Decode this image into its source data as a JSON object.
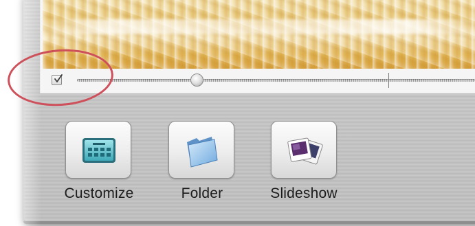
{
  "viewer": {
    "show_checkbox_checked": true,
    "zoom_slider_value": 0.3
  },
  "toolbar": {
    "items": [
      {
        "label": "Customize",
        "icon": "customize-grid-icon"
      },
      {
        "label": "Folder",
        "icon": "folder-icon"
      },
      {
        "label": "Slideshow",
        "icon": "slideshow-icon"
      }
    ]
  },
  "annotation": {
    "highlight_color": "#cd505a"
  }
}
